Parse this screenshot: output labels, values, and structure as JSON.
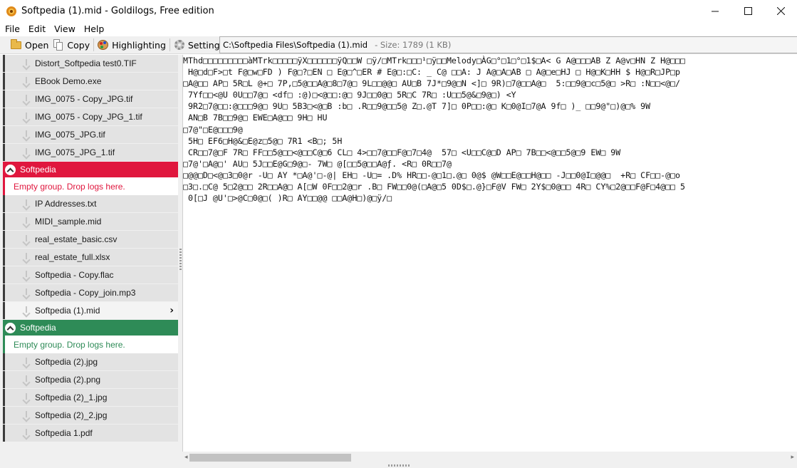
{
  "window": {
    "title": "Softpedia (1).mid - Goldilogs, Free edition",
    "controls": {
      "minimize": "minimize",
      "maximize": "maximize",
      "close": "close"
    }
  },
  "menu": [
    "File",
    "Edit",
    "View",
    "Help"
  ],
  "toolbar": {
    "open_label": "Open",
    "copy_label": "Copy",
    "highlighting_label": "Highlighting",
    "settings_label": "Settings"
  },
  "path": {
    "file": "C:\\Softpedia Files\\Softpedia (1).mid",
    "size": "- Size: 1789 (1 KB)"
  },
  "sidebar": {
    "top_files": [
      "Distort_Softpedia test0.TIF",
      "EBook Demo.exe",
      "IMG_0075 - Copy_JPG.tif",
      "IMG_0075 - Copy_JPG_1.tif",
      "IMG_0075_JPG.tif",
      "IMG_0075_JPG_1.tif"
    ],
    "group_red": {
      "name": "Softpedia",
      "empty_text": "Empty group. Drop logs here.",
      "color": "#e0173e"
    },
    "middle_files": [
      "IP Addresses.txt",
      "MIDI_sample.mid",
      "real_estate_basic.csv",
      "real_estate_full.xlsx",
      "Softpedia - Copy.flac",
      "Softpedia - Copy_join.mp3",
      "Softpedia (1).mid"
    ],
    "group_green": {
      "name": "Softpedia",
      "empty_text": "Empty group. Drop logs here.",
      "color": "#2e8b57"
    },
    "bottom_files": [
      "Softpedia (2).jpg",
      "Softpedia (2).png",
      "Softpedia (2)_1.jpg",
      "Softpedia (2)_2.jpg",
      "Softpedia 1.pdf"
    ]
  },
  "content": {
    "lines": [
      "MThd□□□□□□□□□àMTrk□□□□□ÿX□□□□□□ÿQ□□W □ÿ/□MTrk□□□¹□ÿ□□Melody□ÀG□°□1□°□1$□A< G A@□□□AB Z A@v□HN Z H@□□□",
      " H@□d□F>□t F@□w□FD ) F@□?□EN □ E@□^□ER # E@□:□C: _ C@ □□A: J A@□A□AB □ A@□e□HJ □ H@□K□HH $ H@□R□JP□p",
      "□A@□□ AP□ 5R□L @+□ 7P,□5@□□A@□8□7@□ 9L□□@@□ AU□B 7J*□9@□N <]□ 9R)□7@□□A@□  5:□□9@□c□5@□ >R□ :N□□<@□/",
      " 7Yf□□<@U 0U□□7@□ <df□ :@)□<@□□:@□ 9J□□0@□ 5R□C 7R□ :U□□5@&□9@□) <Y",
      " 9R2□7@□□:@□□□9@□ 9U□ 5B3□<@□B :b□ .R□□9@□□5@ Z□.@T 7]□ 0P□□:@□ K□0@I□7@A 9f□ )_ □□9@\"□)@□% 9W",
      " AN□B 7B□□9@□ EWE□A@□□ 9H□ HU",
      "□7@\"□E@□□□9@",
      " 5H□ EF6□H@&□E@z□5@□ 7R1 <B□; 5H",
      " CR□□7@□F 7R□ FF□□5@□□<@□□C@□6 CL□ 4>□□7@□□F@□7□4@  57□ <U□□C@□D AP□ 7B□□<@□□5@□9 EW□ 9W",
      "□7@'□A@□' AU□ 5J□□E@G□9@□- 7W□ @[□□5@□□A@ƒ. <R□ 0R□□7@",
      "□@@□D□<@□3□0@r -U□ AY *□A@'□-@| EH□ -U□= .D% HR□□-@□1□.@□ 0@$ @W□□E@□□H@□□ -J□□0@I□@@□  +R□ CF□□-@□o",
      "□3□.□C@ 5□2@□□ 2R□□A@□ A[□W 0F□□2@□r .B□ FW□□0@(□A@□5 0D$□.@}□F@V FW□ 2Y$□0@□□ 4R□ CY%□2@□□F@F□4@□□ 5",
      " 0[□J @U'□>@C□0@□( )R□ AY□□@@ □□A@H□)@□ÿ/□"
    ]
  }
}
